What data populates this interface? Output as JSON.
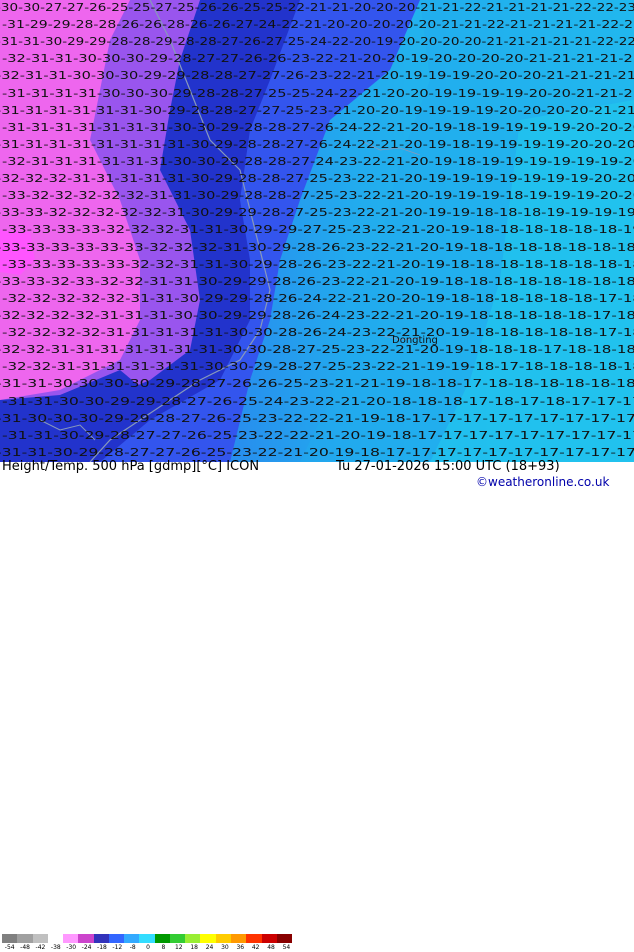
{
  "header": {
    "title": "Height/Temp. 500 hPa [gdmp][°C] ICON",
    "datetime": "Tu 27-01-2026 15:00 UTC (18+93)",
    "credit": "©weatheronline.co.uk"
  },
  "map": {
    "city_label": "Dongting",
    "colors": {
      "pink": "#ee66ee",
      "pink_dark": "#cc44cc",
      "magenta": "#ff55ff",
      "violet": "#9955ee",
      "blue_dark": "#2233cc",
      "blue": "#3355ee",
      "blue_mid": "#3388ee",
      "blue_light": "#22aaee",
      "cyan": "#22ccee",
      "coast": "#8899bb"
    },
    "isolines_note": "",
    "rows": [
      "-30-30-27-27-26-25-25-27-25-26-26-25-25-22-21-21-20-20-20-21-21-22-21-21-21-21-22-22-23",
      "-31-29-29-28-28-26-26-28-26-26-27-24-22-21-20-20-20-20-20-21-21-22-21-21-21-21-22-22",
      "-31-31-30-29-29-28-28-29-28-28-27-26-27-25-24-22-20-19-20-20-20-20-21-21-21-21-21-22-22",
      "-32-31-31-30-30-30-29-28-27-27-26-26-23-22-21-20-20-19-20-20-20-20-21-21-21-21-21",
      "-32-31-31-30-30-30-29-29-28-28-27-27-26-23-22-21-20-19-19-19-20-20-20-21-21-21-21",
      "-31-31-31-31-30-30-30-29-28-28-27-25-25-24-22-21-20-20-19-19-19-19-20-20-21-21-21",
      "-31-31-31-31-31-31-30-29-28-28-27-27-25-23-21-20-20-19-19-19-19-20-20-20-20-21-21",
      "-31-31-31-31-31-31-31-30-30-29-28-28-27-26-24-22-21-20-19-18-19-19-19-19-20-20-20",
      "-31-31-31-31-31-31-31-31-30-29-28-28-27-26-24-22-21-20-19-18-19-19-19-19-20-20-20",
      "-32-31-31-31-31-31-31-30-30-29-28-28-27-24-23-22-21-20-19-18-19-19-19-19-19-19-20",
      "-32-32-32-31-31-31-31-31-30-29-28-28-27-25-23-22-21-20-19-19-19-19-19-19-19-20-20",
      "-33-32-32-32-32-32-31-31-30-29-28-28-27-25-23-22-21-20-19-19-19-18-19-19-19-20-20",
      "-33-33-32-32-32-32-32-31-30-29-29-28-27-25-23-22-21-20-19-19-18-18-18-19-19-19-19",
      "-33-33-33-33-32-32-32-31-31-30-29-29-27-25-23-22-21-20-19-18-18-18-18-18-18-19",
      "-33-33-33-33-33-33-32-32-32-31-30-29-28-26-23-22-21-20-19-18-18-18-18-18-18-18",
      "-33-33-33-33-33-32-32-31-31-30-29-28-26-23-22-21-20-19-18-18-18-18-18-18-18-18",
      "-33-33-32-33-32-32-31-31-30-29-29-28-26-23-22-21-20-19-18-18-18-18-18-18-18-18",
      "-32-32-32-32-32-31-31-30-29-29-28-26-24-22-21-20-20-19-18-18-18-18-18-18-17-18",
      "-32-32-32-32-31-31-31-30-30-29-29-28-26-24-23-22-21-20-19-18-18-18-18-18-17-18",
      "-32-32-32-32-31-31-31-31-31-30-30-28-26-24-23-22-21-20-19-18-18-18-18-18-17-18",
      "-32-32-31-31-31-31-31-31-31-30-30-28-27-25-23-22-21-20-19-18-18-18-17-18-18-18",
      "-32-32-31-31-31-31-31-31-30-30-29-28-27-25-23-22-21-19-19-18-17-18-18-18-18-18",
      "-31-31-30-30-30-30-29-28-27-26-26-25-23-21-21-19-18-18-17-18-18-18-18-18-18",
      "-31-31-30-30-29-29-28-27-26-25-24-23-22-21-20-18-18-18-17-18-17-18-17-17-17",
      "-31-30-30-30-29-29-28-27-26-25-23-22-22-21-19-18-17-17-17-17-17-17-17-17-17",
      "-31-31-30-29-28-27-27-26-25-23-22-22-21-20-19-18-17-17-17-17-17-17-17-17-17",
      "-31-31-30-29-28-27-27-26-25-23-22-21-20-19-18-17-17-17-17-17-17-17-17-17-17"
    ]
  },
  "legend": {
    "ticks": [
      "-54",
      "-48",
      "-42",
      "-38",
      "-30",
      "-24",
      "-18",
      "-12",
      "-8",
      "0",
      "8",
      "12",
      "18",
      "24",
      "30",
      "36",
      "42",
      "48",
      "54"
    ],
    "colors": [
      "#808080",
      "#a0a0a0",
      "#c0c0c0",
      "#ffffff",
      "#ff99ff",
      "#cc44cc",
      "#3333bb",
      "#3366ff",
      "#33aaff",
      "#33ddff",
      "#009900",
      "#33cc33",
      "#99ee33",
      "#ffff00",
      "#ffcc00",
      "#ff9900",
      "#ff3300",
      "#cc0000",
      "#880000"
    ]
  }
}
